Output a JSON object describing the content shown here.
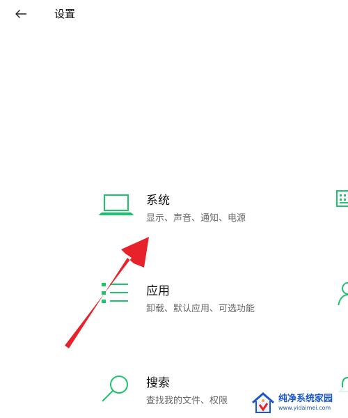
{
  "header": {
    "back_icon": "arrow-left-icon",
    "title": "设置"
  },
  "tiles": [
    {
      "name": "系统",
      "desc": "显示、声音、通知、电源",
      "icon": "laptop-icon"
    },
    {
      "name": "应用",
      "desc": "卸载、默认应用、可选功能",
      "icon": "apps-list-icon"
    },
    {
      "name": "搜索",
      "desc": "查找我的文件、权限",
      "icon": "search-icon"
    }
  ],
  "colors": {
    "accent": "#1ec46c",
    "annotation": "#e8222a",
    "watermark": "#1a56c8"
  },
  "watermark": {
    "name": "纯净系统家园",
    "url": "www.yidaimei.com"
  }
}
